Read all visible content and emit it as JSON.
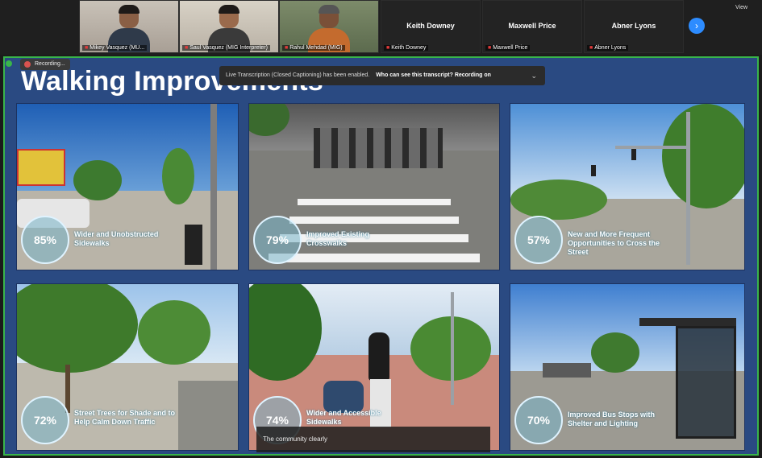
{
  "participants": [
    {
      "name": "Mikey Vasquez (MU...",
      "has_video": true
    },
    {
      "name": "Saul Vasquez (MIG Interpreter)",
      "has_video": true
    },
    {
      "name": "Rahul Mehdad (MIG)",
      "has_video": true
    },
    {
      "name": "Keith Downey",
      "has_video": false
    },
    {
      "name": "Maxwell Price",
      "has_video": false
    },
    {
      "name": "Abner Lyons",
      "has_video": false
    }
  ],
  "controls": {
    "next_icon": "›",
    "view_label": "View"
  },
  "share": {
    "badge_text": "Recording...",
    "border_color": "#39b54a"
  },
  "caption_banner": {
    "notice": "Live Transcription (Closed Captioning) has been enabled.",
    "link": "Who can see this transcript? Recording on",
    "chevron": "⌄"
  },
  "slide": {
    "title": "Walking Improvements",
    "panels": [
      {
        "percent": "85%",
        "label": "Wider and Unobstructed Sidewalks"
      },
      {
        "percent": "79%",
        "label": "Improved Existing Crosswalks"
      },
      {
        "percent": "57%",
        "label": "New and More Frequent Opportunities to Cross the Street"
      },
      {
        "percent": "72%",
        "label": "Street Trees for Shade and to Help Calm Down Traffic"
      },
      {
        "percent": "74%",
        "label": "Wider and Accessible Sidewalks"
      },
      {
        "percent": "70%",
        "label": "Improved Bus Stops with Shelter and Lighting"
      }
    ]
  },
  "live_caption": "The community clearly"
}
